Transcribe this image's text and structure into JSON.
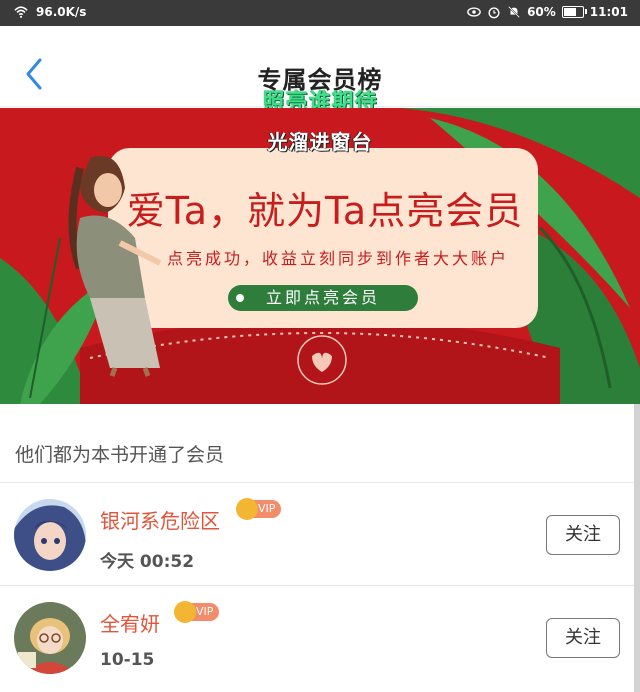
{
  "status_bar": {
    "speed": "96.0K/s",
    "battery": "60%",
    "time": "11:01"
  },
  "header": {
    "title": "专属会员榜"
  },
  "overlays": {
    "line1": "照亮谁期待",
    "line2": "光溜进窗台"
  },
  "banner": {
    "headline": "爱Ta，就为Ta点亮会员",
    "subline": "点亮成功，收益立刻同步到作者大大账户",
    "cta": "立即点亮会员"
  },
  "section_title": "他们都为本书开通了会员",
  "members": [
    {
      "name": "银河系危险区",
      "badge": "VIP",
      "time": "今天 00:52",
      "follow_label": "关注"
    },
    {
      "name": "全宥妍",
      "badge": "VIP",
      "time": "10-15",
      "follow_label": "关注"
    }
  ],
  "colors": {
    "banner_red": "#c8191e",
    "name_orange": "#e2553a",
    "cta_green": "#2f7d3b",
    "overlay_green": "#3fe08a"
  },
  "icons": [
    "wifi-icon",
    "eye-icon",
    "alarm-icon",
    "mute-icon",
    "battery-icon",
    "back-icon",
    "crown-icon"
  ]
}
